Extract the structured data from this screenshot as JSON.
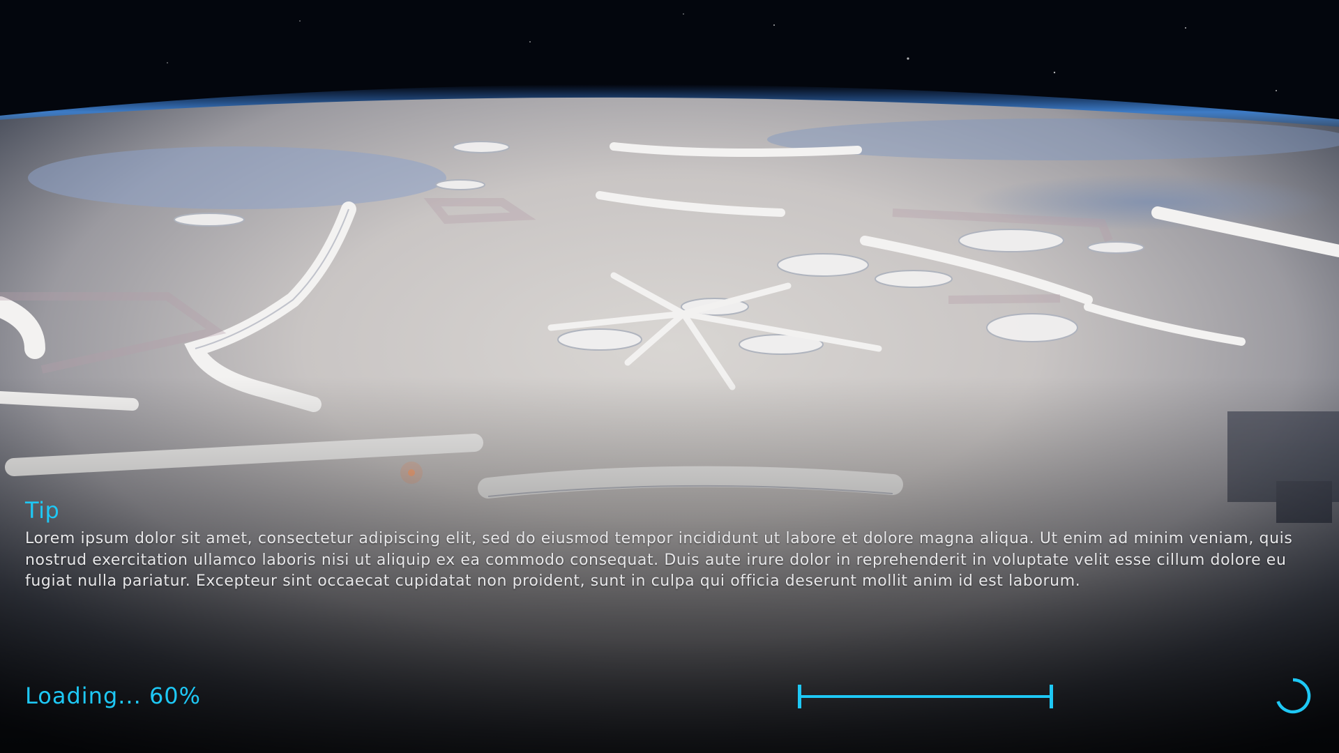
{
  "tip": {
    "title": "Tip",
    "body": "Lorem ipsum dolor sit amet, consectetur adipiscing elit, sed do eiusmod tempor incididunt ut labore et dolore magna aliqua. Ut enim ad minim veniam, quis nostrud exercitation ullamco laboris nisi ut aliquip ex ea commodo consequat. Duis aute irure dolor in reprehenderit in voluptate velit esse cillum dolore eu fugiat nulla pariatur. Excepteur sint occaecat cupidatat non proident, sunt in culpa qui officia deserunt mollit anim id est laborum."
  },
  "loading": {
    "label": "Loading...",
    "percent": "60%",
    "progress_fraction": 1.0
  },
  "icons": {
    "spinner": "loading-spinner-icon"
  },
  "colors": {
    "accent": "#1ec8f5",
    "body_text": "#e8e8ea"
  }
}
